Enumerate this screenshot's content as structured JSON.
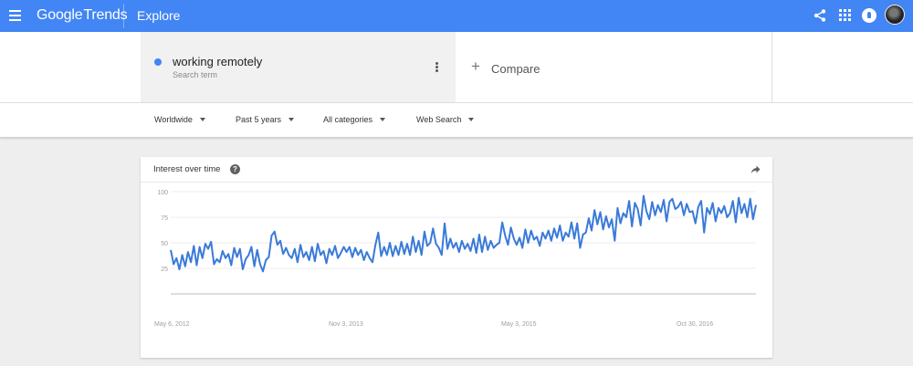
{
  "header": {
    "logo_google": "Google",
    "logo_trends": "Trends",
    "title": "Explore",
    "icons": [
      "menu-icon",
      "share-icon",
      "apps-icon",
      "notifications-icon",
      "avatar"
    ]
  },
  "term": {
    "name": "working remotely",
    "type": "Search term",
    "color": "#4285f4"
  },
  "compare": {
    "plus": "+",
    "label": "Compare"
  },
  "filters": {
    "region": "Worldwide",
    "time": "Past 5 years",
    "category": "All categories",
    "source": "Web Search"
  },
  "card": {
    "title": "Interest over time",
    "help": "?"
  },
  "chart_data": {
    "type": "line",
    "xlabel": "",
    "ylabel": "",
    "ylim": [
      0,
      100
    ],
    "yticks": [
      25,
      50,
      75,
      100
    ],
    "xtick_labels": [
      "May 6, 2012",
      "Nov 3, 2013",
      "May 3, 2015",
      "Oct 30, 2016"
    ],
    "x_start": "May 6, 2012",
    "x_end": "Apr 2017",
    "grid": true,
    "series": [
      {
        "color": "#3a7ad8",
        "values": [
          43,
          29,
          35,
          24,
          38,
          27,
          41,
          31,
          47,
          28,
          46,
          35,
          49,
          44,
          51,
          29,
          34,
          31,
          42,
          35,
          39,
          28,
          45,
          36,
          44,
          24,
          34,
          38,
          46,
          27,
          43,
          29,
          22,
          33,
          36,
          57,
          61,
          48,
          52,
          39,
          45,
          38,
          35,
          44,
          31,
          48,
          36,
          41,
          33,
          46,
          32,
          49,
          38,
          42,
          30,
          44,
          38,
          47,
          35,
          40,
          46,
          41,
          46,
          36,
          45,
          38,
          43,
          33,
          41,
          35,
          31,
          48,
          60,
          37,
          46,
          38,
          50,
          37,
          47,
          38,
          51,
          39,
          49,
          38,
          56,
          41,
          52,
          38,
          61,
          47,
          50,
          64,
          49,
          45,
          38,
          69,
          44,
          54,
          45,
          50,
          41,
          52,
          44,
          49,
          42,
          54,
          40,
          58,
          41,
          56,
          43,
          52,
          45,
          48,
          50,
          70,
          57,
          48,
          65,
          54,
          48,
          55,
          45,
          63,
          50,
          62,
          53,
          56,
          47,
          60,
          54,
          62,
          52,
          64,
          55,
          67,
          52,
          60,
          56,
          70,
          54,
          69,
          45,
          58,
          60,
          74,
          62,
          82,
          68,
          80,
          63,
          76,
          65,
          73,
          52,
          84,
          69,
          79,
          75,
          91,
          66,
          89,
          83,
          67,
          96,
          81,
          73,
          90,
          77,
          87,
          80,
          92,
          71,
          90,
          93,
          83,
          85,
          90,
          77,
          88,
          80,
          81,
          69,
          85,
          91,
          60,
          84,
          78,
          89,
          71,
          84,
          79,
          86,
          75,
          79,
          91,
          70,
          94,
          79,
          88,
          75,
          93,
          73,
          87
        ]
      }
    ]
  }
}
